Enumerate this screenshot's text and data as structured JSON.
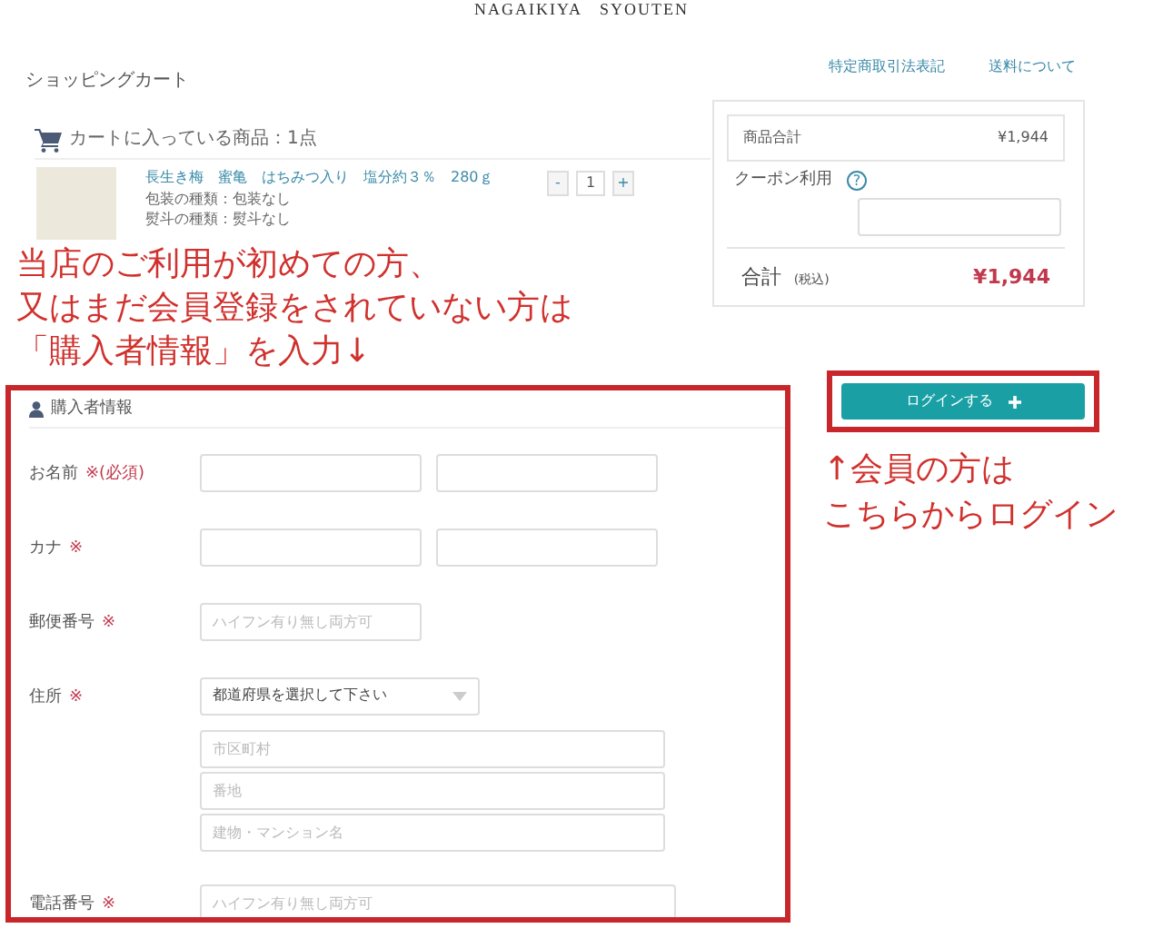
{
  "header": {
    "logo": "NAGAIKIYA　SYOUTEN",
    "links": [
      "特定商取引法表記",
      "送料について"
    ]
  },
  "page_title": "ショッピングカート",
  "cart": {
    "heading": "カートに入っている商品：1点",
    "items": [
      {
        "name": "長生き梅　蜜亀　はちみつ入り　塩分約３％　280ｇ",
        "options": [
          "包装の種類：包装なし",
          "熨斗の種類：熨斗なし"
        ],
        "minus": "-",
        "quantity": "1",
        "plus": "+"
      }
    ]
  },
  "summary": {
    "subtotal_label": "商品合計",
    "subtotal": "¥1,944",
    "coupon_label": "クーポン利用",
    "help": "?",
    "total_label": "合計",
    "tax_note": "(税込)",
    "total": "¥1,944"
  },
  "note_left": [
    "当店のご利用が初めての方、",
    "又はまだ会員登録をされていない方は",
    "「購入者情報」を入力↓"
  ],
  "login_button": "ログインする",
  "note_right": [
    "↑会員の方は",
    "こちらからログイン"
  ],
  "buyer_form": {
    "heading": "購入者情報",
    "fields": [
      {
        "kind": "pair",
        "label": "お名前",
        "required": "※(必須)"
      },
      {
        "kind": "pair",
        "label": "カナ",
        "required": "※"
      },
      {
        "kind": "text",
        "label": "郵便番号",
        "required": "※",
        "placeholder": "ハイフン有り無し両方可"
      },
      {
        "kind": "address",
        "label": "住所",
        "required": "※",
        "select": "都道府県を選択して下さい",
        "placeholders": [
          "市区町村",
          "番地",
          "建物・マンション名"
        ]
      },
      {
        "kind": "wide",
        "label": "電話番号",
        "required": "※",
        "placeholder": "ハイフン有り無し両方可"
      }
    ]
  }
}
